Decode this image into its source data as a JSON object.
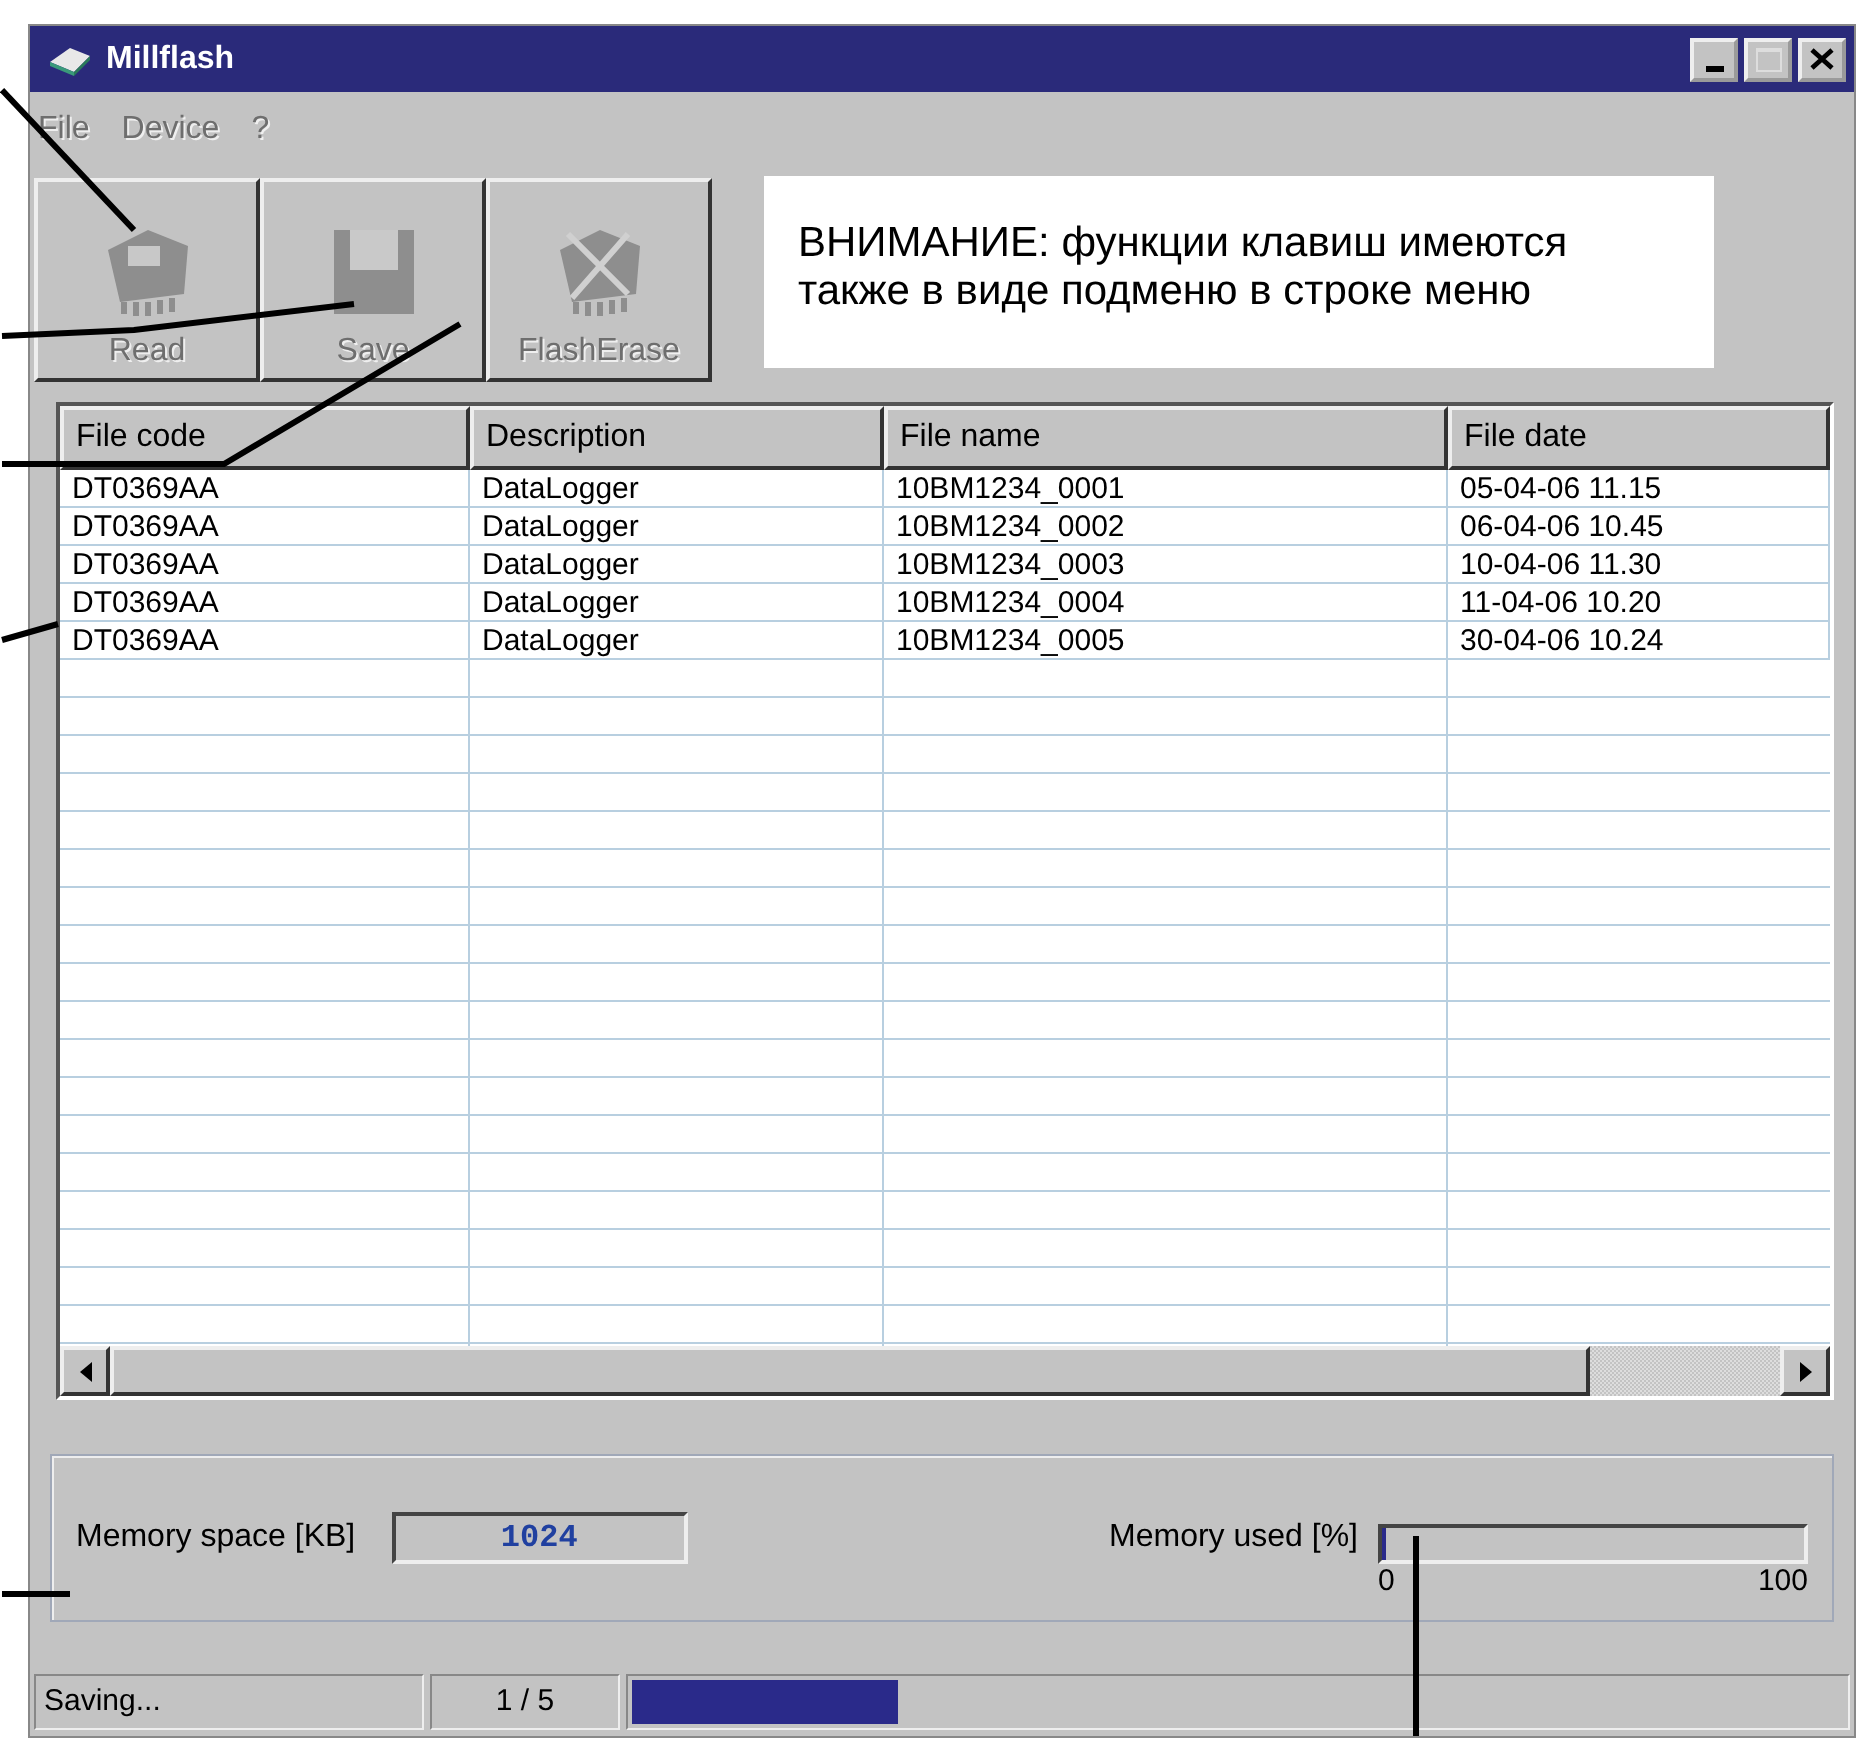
{
  "window": {
    "title": "Millflash"
  },
  "menu": [
    {
      "label": "File",
      "disabled": true
    },
    {
      "label": "Device",
      "disabled": true
    },
    {
      "label": "?",
      "disabled": true
    }
  ],
  "toolbar": [
    {
      "label": "Read",
      "kind": "read",
      "disabled": true
    },
    {
      "label": "Save",
      "kind": "save",
      "disabled": true
    },
    {
      "label": "FlashErase",
      "kind": "erase",
      "disabled": true
    }
  ],
  "note": "ВНИМАНИЕ: функции клавиш имеются также в виде подменю в строке меню",
  "table": {
    "columns": [
      "File code",
      "Description",
      "File name",
      "File date"
    ],
    "rows": [
      [
        "DT0369AA",
        "DataLogger",
        "10BM1234_0001",
        "05-04-06 11.15"
      ],
      [
        "DT0369AA",
        "DataLogger",
        "10BM1234_0002",
        "06-04-06 10.45"
      ],
      [
        "DT0369AA",
        "DataLogger",
        "10BM1234_0003",
        "10-04-06 11.30"
      ],
      [
        "DT0369AA",
        "DataLogger",
        "10BM1234_0004",
        "11-04-06 10.20"
      ],
      [
        "DT0369AA",
        "DataLogger",
        "10BM1234_0005",
        "30-04-06 10.24"
      ]
    ]
  },
  "memory_space": {
    "label": "Memory space [KB]",
    "value": "1024"
  },
  "memory_used": {
    "label": "Memory used [%]",
    "level": 0.01,
    "min_label": "0",
    "max_label": "100"
  },
  "status_bar": {
    "status": "Saving...",
    "count": "1 / 5",
    "level": 0.22
  }
}
